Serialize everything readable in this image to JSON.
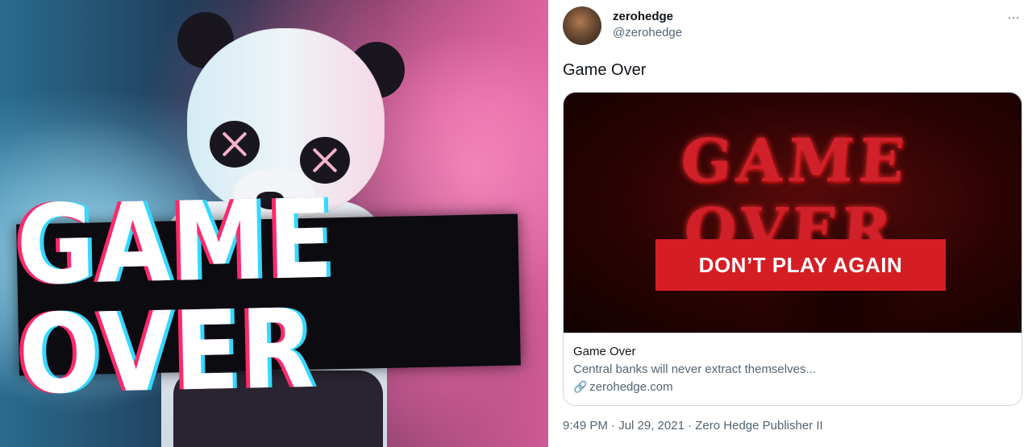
{
  "meme": {
    "sign_text": "GAME OVER"
  },
  "tweet": {
    "display_name": "zerohedge",
    "handle": "@zerohedge",
    "more_icon": "…",
    "text": "Game Over",
    "card": {
      "image_headline": "GAME OVER",
      "image_button": "DON’T PLAY AGAIN",
      "title": "Game Over",
      "description": "Central banks will never extract themselves...",
      "link_icon": "🔗",
      "domain": "zerohedge.com"
    },
    "timestamp": "9:49 PM · Jul 29, 2021 · Zero Hedge Publisher II"
  },
  "colors": {
    "accent_red": "#d41e24",
    "secondary_text": "#536471",
    "primary_text": "#0f1419"
  }
}
